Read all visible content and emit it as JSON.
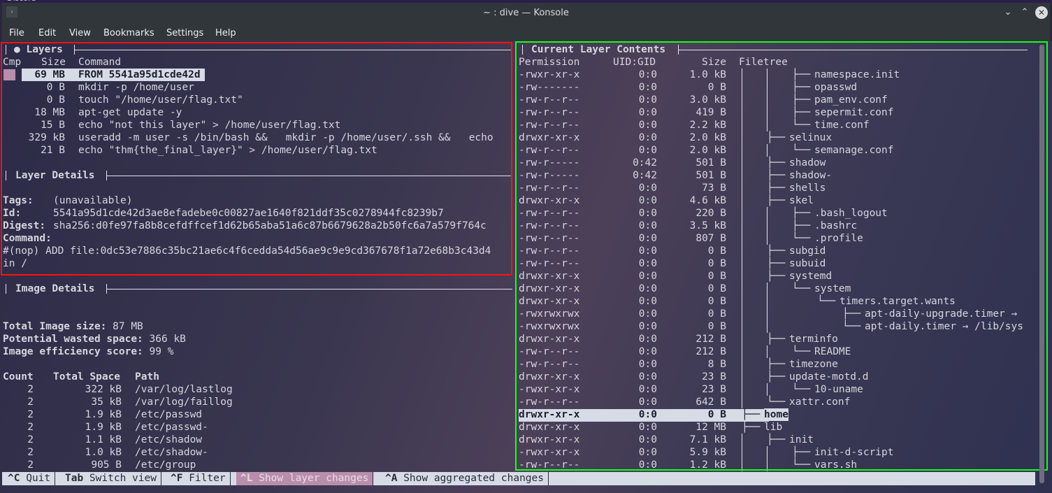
{
  "window": {
    "behind_label": "Discord",
    "title": "~ : dive — Konsole",
    "controls": [
      "minimize",
      "maximize",
      "close"
    ]
  },
  "menubar": [
    "File",
    "Edit",
    "View",
    "Bookmarks",
    "Settings",
    "Help"
  ],
  "layers": {
    "title": "● Layers",
    "headers": {
      "cmp": "Cmp",
      "size": "Size",
      "command": "Command"
    },
    "rows": [
      {
        "size": "69 MB",
        "command": "FROM 5541a95d1cde42d",
        "selected": true
      },
      {
        "size": "0 B",
        "command": "mkdir -p /home/user"
      },
      {
        "size": "0 B",
        "command": "touch \"/home/user/flag.txt\""
      },
      {
        "size": "18 MB",
        "command": "apt-get update -y"
      },
      {
        "size": "15 B",
        "command": "echo \"not this layer\" > /home/user/flag.txt"
      },
      {
        "size": "329 kB",
        "command": "useradd -m user -s /bin/bash &&   mkdir -p /home/user/.ssh &&   echo"
      },
      {
        "size": "21 B",
        "command": "echo \"thm{the_final_layer}\" > /home/user/flag.txt"
      }
    ]
  },
  "layer_details": {
    "title": "Layer Details",
    "tags_label": "Tags:",
    "tags_value": "(unavailable)",
    "id_label": "Id:",
    "id_value": "5541a95d1cde42d3ae8efadebe0c00827ae1640f821ddf35c0278944fc8239b7",
    "digest_label": "Digest:",
    "digest_value": "sha256:d0fe97fa8b8cefdffcef1d62b65aba51a6c87b6679628a2b50fc6a7a579f764c",
    "command_label": "Command:",
    "command_line1": "#(nop) ADD file:0dc53e7886c35bc21ae6c4f6cedda54d56ae9c9e9cd367678f1a72e68b3c43d4",
    "command_line2": "in /"
  },
  "image_details": {
    "title": "Image Details",
    "total_size_label": "Total Image size:",
    "total_size_value": "87 MB",
    "wasted_label": "Potential wasted space:",
    "wasted_value": "366 kB",
    "efficiency_label": "Image efficiency score:",
    "efficiency_value": "99 %",
    "headers": {
      "count": "Count",
      "space": "Total Space",
      "path": "Path"
    },
    "rows": [
      {
        "count": "2",
        "space": "322 kB",
        "path": "/var/log/lastlog"
      },
      {
        "count": "2",
        "space": "35 kB",
        "path": "/var/log/faillog"
      },
      {
        "count": "2",
        "space": "1.9 kB",
        "path": "/etc/passwd"
      },
      {
        "count": "2",
        "space": "1.9 kB",
        "path": "/etc/passwd-"
      },
      {
        "count": "2",
        "space": "1.1 kB",
        "path": "/etc/shadow"
      },
      {
        "count": "2",
        "space": "1.0 kB",
        "path": "/etc/shadow-"
      },
      {
        "count": "2",
        "space": "905 B",
        "path": "/etc/group"
      }
    ]
  },
  "contents": {
    "title": "Current Layer Contents",
    "headers": {
      "perm": "Permission",
      "uid": "UID:GID",
      "size": "Size",
      "tree": "Filetree"
    },
    "rows": [
      {
        "perm": "-rwxr-xr-x",
        "uid": "0:0",
        "size": "1.0 kB",
        "depth": 3,
        "name": "namespace.init",
        "branch": "├──"
      },
      {
        "perm": "-rw-------",
        "uid": "0:0",
        "size": "0 B",
        "depth": 3,
        "name": "opasswd",
        "branch": "├──"
      },
      {
        "perm": "-rw-r--r--",
        "uid": "0:0",
        "size": "3.0 kB",
        "depth": 3,
        "name": "pam_env.conf",
        "branch": "├──"
      },
      {
        "perm": "-rw-r--r--",
        "uid": "0:0",
        "size": "419 B",
        "depth": 3,
        "name": "sepermit.conf",
        "branch": "├──"
      },
      {
        "perm": "-rw-r--r--",
        "uid": "0:0",
        "size": "2.2 kB",
        "depth": 3,
        "name": "time.conf",
        "branch": "└──"
      },
      {
        "perm": "drwxr-xr-x",
        "uid": "0:0",
        "size": "2.0 kB",
        "depth": 2,
        "name": "selinux",
        "branch": "├──"
      },
      {
        "perm": "-rw-r--r--",
        "uid": "0:0",
        "size": "2.0 kB",
        "depth": 3,
        "name": "semanage.conf",
        "branch": "└──"
      },
      {
        "perm": "-rw-r-----",
        "uid": "0:42",
        "size": "501 B",
        "depth": 2,
        "name": "shadow",
        "branch": "├──"
      },
      {
        "perm": "-rw-r-----",
        "uid": "0:42",
        "size": "501 B",
        "depth": 2,
        "name": "shadow-",
        "branch": "├──"
      },
      {
        "perm": "-rw-r--r--",
        "uid": "0:0",
        "size": "73 B",
        "depth": 2,
        "name": "shells",
        "branch": "├──"
      },
      {
        "perm": "drwxr-xr-x",
        "uid": "0:0",
        "size": "4.6 kB",
        "depth": 2,
        "name": "skel",
        "branch": "├──"
      },
      {
        "perm": "-rw-r--r--",
        "uid": "0:0",
        "size": "220 B",
        "depth": 3,
        "name": ".bash_logout",
        "branch": "├──"
      },
      {
        "perm": "-rw-r--r--",
        "uid": "0:0",
        "size": "3.5 kB",
        "depth": 3,
        "name": ".bashrc",
        "branch": "├──"
      },
      {
        "perm": "-rw-r--r--",
        "uid": "0:0",
        "size": "807 B",
        "depth": 3,
        "name": ".profile",
        "branch": "└──"
      },
      {
        "perm": "-rw-r--r--",
        "uid": "0:0",
        "size": "0 B",
        "depth": 2,
        "name": "subgid",
        "branch": "├──"
      },
      {
        "perm": "-rw-r--r--",
        "uid": "0:0",
        "size": "0 B",
        "depth": 2,
        "name": "subuid",
        "branch": "├──"
      },
      {
        "perm": "drwxr-xr-x",
        "uid": "0:0",
        "size": "0 B",
        "depth": 2,
        "name": "systemd",
        "branch": "├──"
      },
      {
        "perm": "drwxr-xr-x",
        "uid": "0:0",
        "size": "0 B",
        "depth": 3,
        "name": "system",
        "branch": "└──"
      },
      {
        "perm": "drwxr-xr-x",
        "uid": "0:0",
        "size": "0 B",
        "depth": 4,
        "name": "timers.target.wants",
        "branch": "└──"
      },
      {
        "perm": "-rwxrwxrwx",
        "uid": "0:0",
        "size": "0 B",
        "depth": 5,
        "name": "apt-daily-upgrade.timer →",
        "branch": "├──"
      },
      {
        "perm": "-rwxrwxrwx",
        "uid": "0:0",
        "size": "0 B",
        "depth": 5,
        "name": "apt-daily.timer → /lib/sys",
        "branch": "└──"
      },
      {
        "perm": "drwxr-xr-x",
        "uid": "0:0",
        "size": "212 B",
        "depth": 2,
        "name": "terminfo",
        "branch": "├──"
      },
      {
        "perm": "-rw-r--r--",
        "uid": "0:0",
        "size": "212 B",
        "depth": 3,
        "name": "README",
        "branch": "└──"
      },
      {
        "perm": "-rw-r--r--",
        "uid": "0:0",
        "size": "8 B",
        "depth": 2,
        "name": "timezone",
        "branch": "├──"
      },
      {
        "perm": "drwxr-xr-x",
        "uid": "0:0",
        "size": "23 B",
        "depth": 2,
        "name": "update-motd.d",
        "branch": "├──"
      },
      {
        "perm": "-rwxr-xr-x",
        "uid": "0:0",
        "size": "23 B",
        "depth": 3,
        "name": "10-uname",
        "branch": "└──"
      },
      {
        "perm": "-rw-r--r--",
        "uid": "0:0",
        "size": "642 B",
        "depth": 2,
        "name": "xattr.conf",
        "branch": "└──"
      },
      {
        "perm": "drwxr-xr-x",
        "uid": "0:0",
        "size": "0 B",
        "depth": 1,
        "name": "home",
        "branch": "├──",
        "selected": true
      },
      {
        "perm": "drwxr-xr-x",
        "uid": "0:0",
        "size": "12 MB",
        "depth": 1,
        "name": "lib",
        "branch": "├──"
      },
      {
        "perm": "drwxr-xr-x",
        "uid": "0:0",
        "size": "7.1 kB",
        "depth": 2,
        "name": "init",
        "branch": "├──"
      },
      {
        "perm": "-rwxr-xr-x",
        "uid": "0:0",
        "size": "5.9 kB",
        "depth": 3,
        "name": "init-d-script",
        "branch": "├──"
      },
      {
        "perm": "-rw-r--r--",
        "uid": "0:0",
        "size": "1.2 kB",
        "depth": 3,
        "name": "vars.sh",
        "branch": "└──"
      }
    ]
  },
  "statusbar": [
    {
      "key": "^C",
      "label": " Quit"
    },
    {
      "key": "Tab",
      "label": " Switch view"
    },
    {
      "key": "^F",
      "label": " Filter"
    },
    {
      "key": "^L",
      "label": " Show layer changes",
      "active": true
    },
    {
      "key": "^A",
      "label": " Show aggregated changes"
    }
  ],
  "colors": {
    "selection_bg": "#d6dbe6",
    "cmp_marker": "#b98eac",
    "red_box": "#ff1010",
    "green_box": "#14ff14"
  }
}
